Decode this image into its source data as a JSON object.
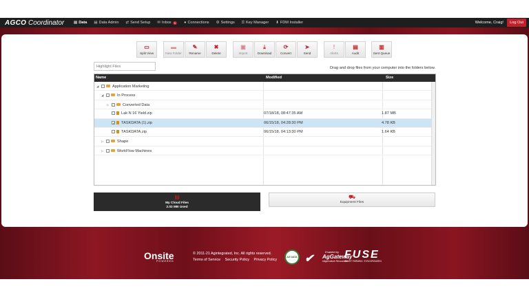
{
  "app": {
    "logo_brand": "AGCO",
    "logo_product": "Coordinator"
  },
  "nav": [
    {
      "icon": "file",
      "label": "Data",
      "active": true
    },
    {
      "icon": "file",
      "label": "Data Admin"
    },
    {
      "icon": "sync",
      "label": "Send Setup"
    },
    {
      "icon": "mail",
      "label": "Inbox",
      "badge": "1"
    },
    {
      "icon": "user",
      "label": "Connections"
    },
    {
      "icon": "gear",
      "label": "Settings"
    },
    {
      "icon": "key",
      "label": "Key Manager"
    },
    {
      "icon": "download",
      "label": "FDM Installer"
    }
  ],
  "header": {
    "welcome": "Welcome, Craig!",
    "logout": "Log Out"
  },
  "toolbar": {
    "split_view": "Split View",
    "new_folder": "New Folder",
    "rename": "Rename",
    "delete": "Delete",
    "import": "Import",
    "download": "Download",
    "convert": "Convert",
    "send": "Send",
    "alerts": "Alerts",
    "audit": "Audit",
    "sent_queue": "Sent Queue"
  },
  "search": {
    "placeholder": "Highlight Files"
  },
  "hint": "Drag and drop files from your computer into the folders below.",
  "grid": {
    "columns": [
      "Name",
      "Modified",
      "Size"
    ],
    "rows": [
      {
        "name": "Application Marketing",
        "type": "folder",
        "expanded": true,
        "modified": "",
        "size": ""
      },
      {
        "name": "In Process",
        "type": "folder",
        "expanded": true,
        "modified": "",
        "size": ""
      },
      {
        "name": "Converted Data",
        "type": "folder",
        "expanded": false,
        "modified": "",
        "size": ""
      },
      {
        "name": "Lak N 16 Yield.zip",
        "type": "file",
        "modified": "07/18/18, 08:47:35 AM",
        "size": "1.87 MB"
      },
      {
        "name": "TASKDATA (1).zip",
        "type": "file",
        "checked": true,
        "selected": true,
        "modified": "06/15/18, 04:28:30 PM",
        "size": "4.78 KB"
      },
      {
        "name": "TASKDATA.zip",
        "type": "file",
        "modified": "06/15/18, 04:13:30 PM",
        "size": "1.64 KB"
      },
      {
        "name": "Shape",
        "type": "folder",
        "expanded": false,
        "modified": "",
        "size": ""
      },
      {
        "name": "WorkFlow Machines",
        "type": "folder",
        "expanded": false,
        "modified": "",
        "size": ""
      }
    ]
  },
  "cloud": {
    "title": "My Cloud Files",
    "used": "2.02 MB Used"
  },
  "equipment": {
    "title": "Equipment Files"
  },
  "footer": {
    "onsite": "Onsite",
    "powered": "POWERED",
    "copyright": "© 2011-21 Agintegrated, Inc. All rights reserved.",
    "links": [
      "Terms of Service",
      "Security Policy",
      "Privacy Policy"
    ],
    "seal": "AG DATA",
    "enabled_by": "Enabled by",
    "aggateway": "AgGateway",
    "aggateway_sub": "eAgriculture Resources",
    "fuse": "FUSE",
    "fuse_tag": "SMART FARMING. SYNCHRONIZED."
  },
  "colors": {
    "accent": "#c0202a",
    "topbar": "#1e1e1e",
    "band": "#8d1723",
    "selected_row": "#cde4f4"
  }
}
